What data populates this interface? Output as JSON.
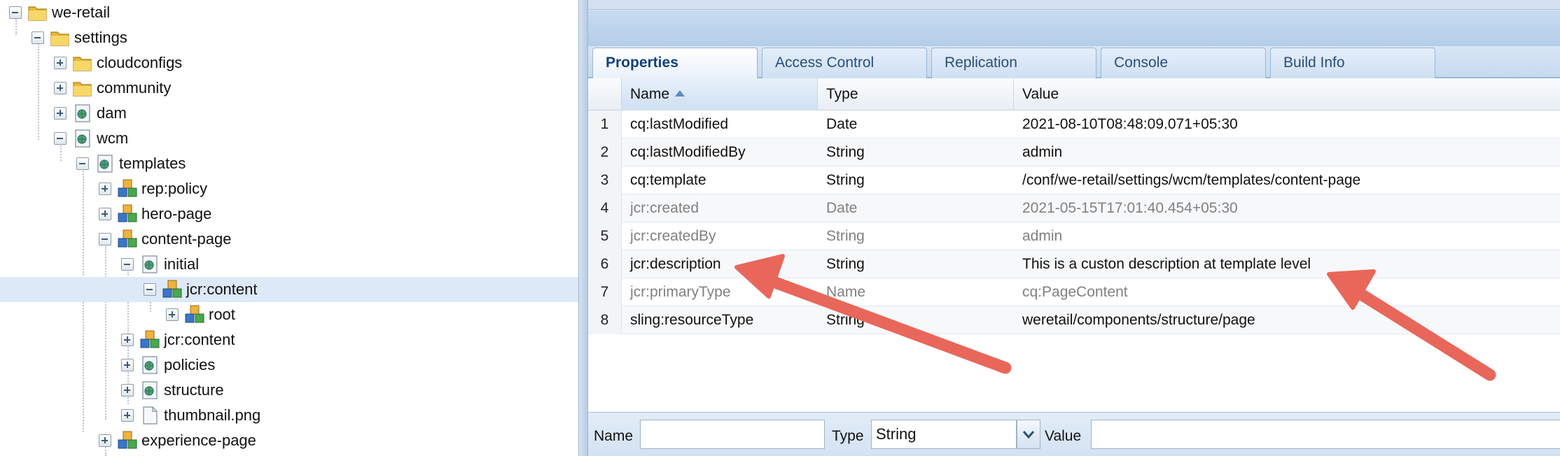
{
  "tree": {
    "nodes": [
      {
        "label": "we-retail"
      },
      {
        "label": "settings"
      },
      {
        "label": "cloudconfigs"
      },
      {
        "label": "community"
      },
      {
        "label": "dam"
      },
      {
        "label": "wcm"
      },
      {
        "label": "templates"
      },
      {
        "label": "rep:policy"
      },
      {
        "label": "hero-page"
      },
      {
        "label": "content-page"
      },
      {
        "label": "initial"
      },
      {
        "label": "jcr:content"
      },
      {
        "label": "root"
      },
      {
        "label": "jcr:content"
      },
      {
        "label": "policies"
      },
      {
        "label": "structure"
      },
      {
        "label": "thumbnail.png"
      },
      {
        "label": "experience-page"
      }
    ]
  },
  "tabs": [
    {
      "label": "Properties"
    },
    {
      "label": "Access Control"
    },
    {
      "label": "Replication"
    },
    {
      "label": "Console"
    },
    {
      "label": "Build Info"
    }
  ],
  "grid": {
    "columns": {
      "name": "Name",
      "type": "Type",
      "value": "Value"
    },
    "rows": [
      {
        "num": "1",
        "name": "cq:lastModified",
        "type": "Date",
        "value": "2021-08-10T08:48:09.071+05:30"
      },
      {
        "num": "2",
        "name": "cq:lastModifiedBy",
        "type": "String",
        "value": "admin"
      },
      {
        "num": "3",
        "name": "cq:template",
        "type": "String",
        "value": "/conf/we-retail/settings/wcm/templates/content-page"
      },
      {
        "num": "4",
        "name": "jcr:created",
        "type": "Date",
        "value": "2021-05-15T17:01:40.454+05:30"
      },
      {
        "num": "5",
        "name": "jcr:createdBy",
        "type": "String",
        "value": "admin"
      },
      {
        "num": "6",
        "name": "jcr:description",
        "type": "String",
        "value": "This is a custon description at template level"
      },
      {
        "num": "7",
        "name": "jcr:primaryType",
        "type": "Name",
        "value": "cq:PageContent"
      },
      {
        "num": "8",
        "name": "sling:resourceType",
        "type": "String",
        "value": "weretail/components/structure/page"
      }
    ]
  },
  "editbar": {
    "name_label": "Name",
    "type_label": "Type",
    "type_value": "String",
    "value_label": "Value",
    "name_value": "",
    "value_value": ""
  },
  "colors": {
    "arrow": "#e8675a",
    "selected_row": "#dde9f6",
    "panel_bg": "#dbe7f5"
  }
}
